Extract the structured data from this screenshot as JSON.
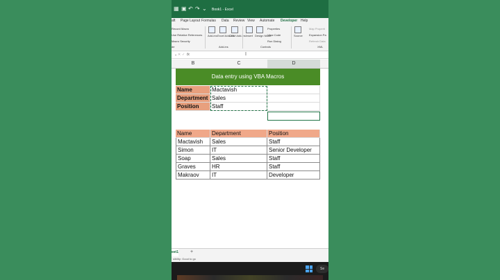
{
  "titlebar": {
    "title": "Book1 - Excel"
  },
  "menu": [
    "aft",
    "Page Layout",
    "Formulas",
    "Data",
    "Review",
    "View",
    "Automate",
    "Developer",
    "Help"
  ],
  "ribbon": {
    "code": {
      "record_macro": "Record Macro",
      "relative_refs": "Use Relative References",
      "macro_security": "Macro Security",
      "group_tail": "de"
    },
    "addins": {
      "addins": "Add-ins",
      "excel_addins": "Excel Add-ins",
      "com_addins": "COM Add-ins",
      "group": "Add-ins"
    },
    "controls": {
      "insert": "Insert",
      "design_mode": "Design Mode",
      "properties": "Properties",
      "view_code": "View Code",
      "run_dialog": "Run Dialog",
      "group": "Controls"
    },
    "xml": {
      "source": "Source",
      "map_props": "Map Properti",
      "expansion": "Expansion Pa",
      "refresh": "Refresh Data",
      "group": "XML"
    }
  },
  "formula_bar": {
    "fx": "fx"
  },
  "columns": [
    "B",
    "C",
    "D"
  ],
  "banner": "Data entry using VBA Macros",
  "form": [
    {
      "label": "Name",
      "value": "Mactavish"
    },
    {
      "label": "Department",
      "value": "Sales"
    },
    {
      "label": "Position",
      "value": "Staff"
    }
  ],
  "table": {
    "headers": [
      "Name",
      "Department",
      "Position"
    ],
    "rows": [
      [
        "Mactavish",
        "Sales",
        "Staff"
      ],
      [
        "Simon",
        "IT",
        "Senior Developer"
      ],
      [
        "Soap",
        "Sales",
        "Staff"
      ],
      [
        "Graves",
        "HR",
        "Staff"
      ],
      [
        "Makraov",
        "IT",
        "Developer"
      ]
    ]
  },
  "sheet_tab": "eet1",
  "add_sheet": "+",
  "status": "sibility: Good to go",
  "search": "Se",
  "colors": {
    "excel_green": "#1e6e42",
    "banner_green": "#4a8c26",
    "label_orange": "#e8a07e",
    "header_orange": "#f0a889"
  }
}
